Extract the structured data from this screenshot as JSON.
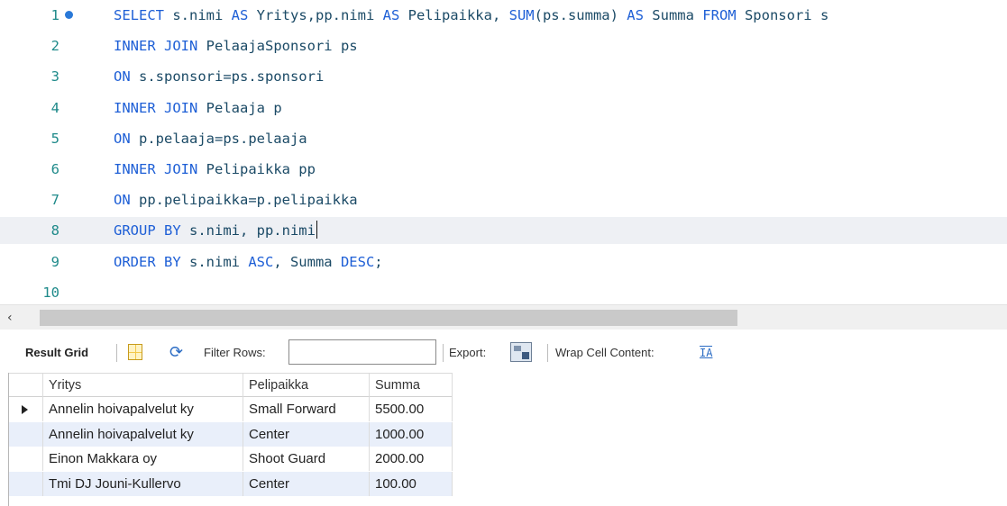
{
  "editor": {
    "lines": [
      {
        "num": "1",
        "dot": true,
        "current": false,
        "tokens": [
          {
            "t": "SELECT",
            "k": "kw"
          },
          {
            "t": " s.nimi ",
            "k": "id"
          },
          {
            "t": "AS",
            "k": "kw"
          },
          {
            "t": " Yritys,pp.nimi ",
            "k": "id"
          },
          {
            "t": "AS",
            "k": "kw"
          },
          {
            "t": " Pelipaikka, ",
            "k": "id"
          },
          {
            "t": "SUM",
            "k": "fn"
          },
          {
            "t": "(ps.summa) ",
            "k": "id"
          },
          {
            "t": "AS",
            "k": "kw"
          },
          {
            "t": " Summa ",
            "k": "id"
          },
          {
            "t": "FROM",
            "k": "kw"
          },
          {
            "t": " Sponsori s",
            "k": "id"
          }
        ]
      },
      {
        "num": "2",
        "dot": false,
        "current": false,
        "tokens": [
          {
            "t": "INNER JOIN",
            "k": "kw"
          },
          {
            "t": " PelaajaSponsori ps",
            "k": "id"
          }
        ]
      },
      {
        "num": "3",
        "dot": false,
        "current": false,
        "tokens": [
          {
            "t": "ON",
            "k": "kw"
          },
          {
            "t": " s.sponsori=ps.sponsori",
            "k": "id"
          }
        ]
      },
      {
        "num": "4",
        "dot": false,
        "current": false,
        "tokens": [
          {
            "t": "INNER JOIN",
            "k": "kw"
          },
          {
            "t": " Pelaaja p",
            "k": "id"
          }
        ]
      },
      {
        "num": "5",
        "dot": false,
        "current": false,
        "tokens": [
          {
            "t": "ON",
            "k": "kw"
          },
          {
            "t": " p.pelaaja=ps.pelaaja",
            "k": "id"
          }
        ]
      },
      {
        "num": "6",
        "dot": false,
        "current": false,
        "tokens": [
          {
            "t": "INNER JOIN",
            "k": "kw"
          },
          {
            "t": " Pelipaikka pp",
            "k": "id"
          }
        ]
      },
      {
        "num": "7",
        "dot": false,
        "current": false,
        "tokens": [
          {
            "t": "ON",
            "k": "kw"
          },
          {
            "t": " pp.pelipaikka=p.pelipaikka",
            "k": "id"
          }
        ]
      },
      {
        "num": "8",
        "dot": false,
        "current": true,
        "caret": true,
        "tokens": [
          {
            "t": "GROUP BY",
            "k": "kw"
          },
          {
            "t": " s.nimi, pp.nimi",
            "k": "id"
          }
        ]
      },
      {
        "num": "9",
        "dot": false,
        "current": false,
        "tokens": [
          {
            "t": "ORDER BY",
            "k": "kw"
          },
          {
            "t": " s.nimi ",
            "k": "id"
          },
          {
            "t": "ASC",
            "k": "kw"
          },
          {
            "t": ", Summa ",
            "k": "id"
          },
          {
            "t": "DESC",
            "k": "kw"
          },
          {
            "t": ";",
            "k": "id"
          }
        ]
      },
      {
        "num": "10",
        "dot": false,
        "current": false,
        "tokens": []
      }
    ]
  },
  "scrollbar": {
    "left_arrow": "‹"
  },
  "toolbar": {
    "result_grid_label": "Result Grid",
    "grid_icon": "grid-icon",
    "refresh_icon": "refresh-icon",
    "filter_label": "Filter Rows:",
    "filter_value": "",
    "export_label": "Export:",
    "export_icon": "export-icon",
    "wrap_label": "Wrap Cell Content:",
    "wrap_icon_glyph": "IA"
  },
  "result_grid": {
    "columns": [
      "Yritys",
      "Pelipaikka",
      "Summa"
    ],
    "rows": [
      {
        "current": true,
        "cells": [
          "Annelin hoivapalvelut ky",
          "Small Forward",
          "5500.00"
        ]
      },
      {
        "current": false,
        "cells": [
          "Annelin hoivapalvelut ky",
          "Center",
          "1000.00"
        ]
      },
      {
        "current": false,
        "cells": [
          "Einon Makkara oy",
          "Shoot Guard",
          "2000.00"
        ]
      },
      {
        "current": false,
        "cells": [
          "Tmi DJ Jouni-Kullervo",
          "Center",
          "100.00"
        ]
      }
    ]
  },
  "colors": {
    "keyword": "#1e5fd6",
    "identifier": "#1b4a66",
    "line_number": "#1f8a8a",
    "alt_row": "#e9effa"
  }
}
